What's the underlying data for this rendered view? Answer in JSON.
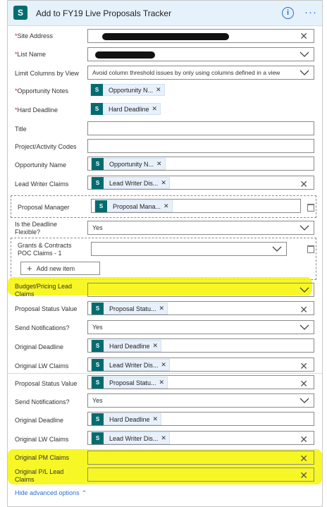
{
  "header": {
    "logo": "S",
    "title": "Add to FY19 Live Proposals Tracker",
    "info_icon": "info-icon",
    "more_icon": "more-icon"
  },
  "fields": {
    "site_address": {
      "label": "Site Address",
      "required_mark": "*"
    },
    "list_name": {
      "label": "List Name",
      "required_mark": "*"
    },
    "limit_columns": {
      "label": "Limit Columns by View",
      "value": "Avoid column threshold issues by only using columns defined in a view"
    },
    "opportunity_notes": {
      "label": "Opportunity Notes",
      "required_mark": "*",
      "chip": "Opportunity N..."
    },
    "hard_deadline": {
      "label": "Hard Deadline",
      "required_mark": "*",
      "chip": "Hard Deadline"
    },
    "title": {
      "label": "Title"
    },
    "project_codes": {
      "label": "Project/Activity Codes"
    },
    "opportunity_name": {
      "label": "Opportunity Name",
      "chip": "Opportunity N..."
    },
    "lead_writer_claims": {
      "label": "Lead Writer Claims",
      "chip": "Lead Writer Dis..."
    },
    "proposal_manager": {
      "label": "Proposal Manager",
      "chip": "Proposal Mana..."
    },
    "deadline_flexible": {
      "label_line1": "Is the Deadline",
      "label_line2": "Flexible?",
      "value": "Yes"
    },
    "grants_contracts": {
      "label_line1": "Grants & Contracts",
      "label_line2": "POC Claims - 1",
      "add_label": "Add new item"
    },
    "budget_pricing": {
      "label_line1": "Budget/Pricing Lead",
      "label_line2": "Claims"
    },
    "proposal_status_1": {
      "label": "Proposal Status Value",
      "chip": "Proposal Statu..."
    },
    "send_notifications_1": {
      "label": "Send Notifications?",
      "value": "Yes"
    },
    "original_deadline_1": {
      "label": "Original Deadline",
      "chip": "Hard Deadline"
    },
    "original_lw_1": {
      "label": "Original LW Claims",
      "chip": "Lead Writer Dis..."
    },
    "proposal_status_2": {
      "label": "Proposal Status Value",
      "chip": "Proposal Statu..."
    },
    "send_notifications_2": {
      "label": "Send Notifications?",
      "value": "Yes"
    },
    "original_deadline_2": {
      "label": "Original Deadline",
      "chip": "Hard Deadline"
    },
    "original_lw_2": {
      "label": "Original LW Claims",
      "chip": "Lead Writer Dis..."
    },
    "original_pm": {
      "label": "Original PM Claims"
    },
    "original_pl": {
      "label_line1": "Original P/L Lead",
      "label_line2": "Claims"
    }
  },
  "footer": {
    "advanced_link": "Hide advanced options"
  },
  "colors": {
    "accent": "#2b6fd6",
    "sharepoint": "#036c70",
    "required": "#c4262e",
    "highlight": "#f6f600"
  }
}
